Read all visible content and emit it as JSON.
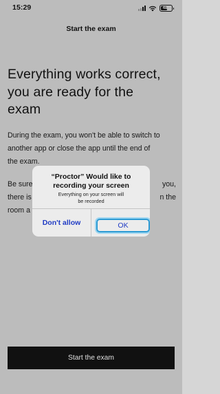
{
  "status_bar": {
    "time": "15:29",
    "battery": "48",
    "icons": [
      "signal-icon",
      "wifi-icon",
      "battery-icon"
    ]
  },
  "header": {
    "title": "Start the exam"
  },
  "main": {
    "headline_lines": [
      "Everything works correct,",
      "you are ready for the",
      "exam"
    ],
    "paragraph1_lines": [
      "During the exam, you won't be able to switch to",
      "another app or close the app until the end of",
      "the exam."
    ],
    "paragraph2_lines": [
      "Be sure",
      "there is",
      "room a"
    ],
    "paragraph2_right_lines": [
      "you,",
      "n the"
    ]
  },
  "alert": {
    "title_lines": [
      "“Proctor” Would like to",
      "recording your screen"
    ],
    "message_lines": [
      "Everything on your screen will",
      "be recorded"
    ],
    "dont_allow_label": "Don't allow",
    "ok_label": "OK"
  },
  "footer": {
    "button_label": "Start the exam"
  }
}
